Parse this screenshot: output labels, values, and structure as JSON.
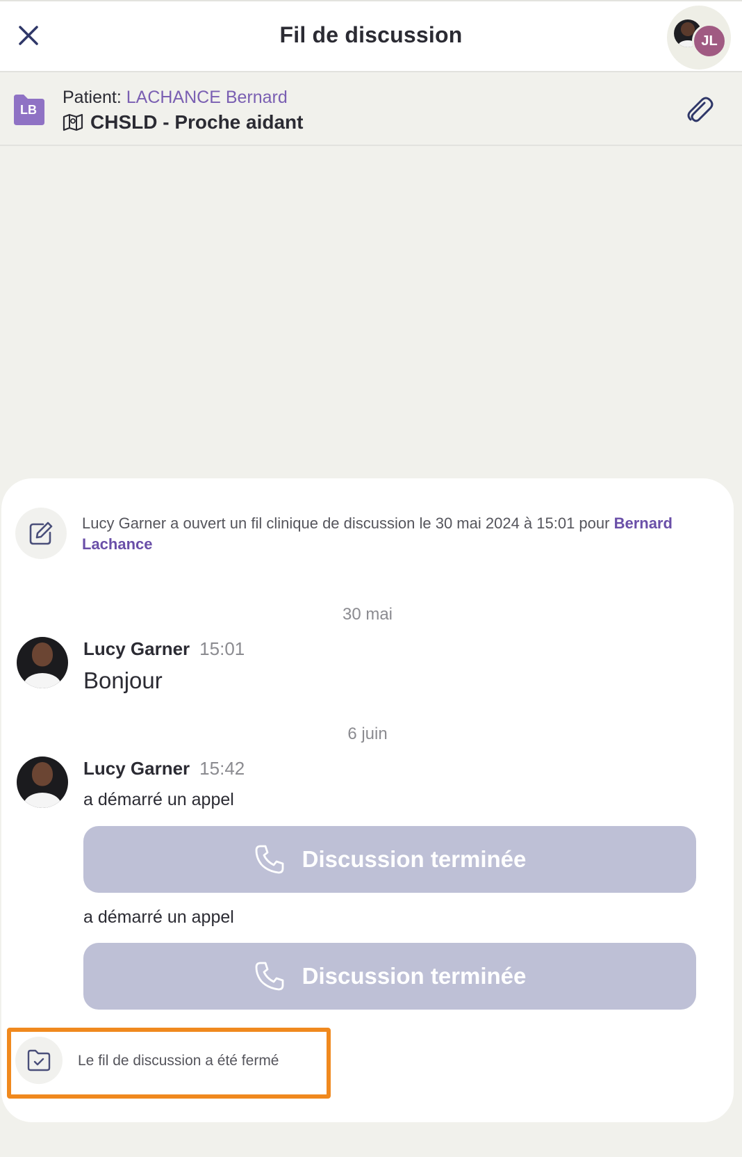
{
  "header": {
    "title": "Fil de discussion",
    "participants_badge": "JL"
  },
  "patient": {
    "initials": "LB",
    "label": "Patient: ",
    "name": "LACHANCE Bernard",
    "group": "CHSLD - Proche aidant"
  },
  "thread": {
    "opened_event": {
      "text": "Lucy Garner a ouvert un fil clinique de discussion le 30 mai 2024 à 15:01 pour ",
      "link": "Bernard Lachance"
    },
    "groups": [
      {
        "date": "30 mai",
        "author": "Lucy Garner",
        "time": "15:01",
        "text": "Bonjour"
      },
      {
        "date": "6 juin",
        "author": "Lucy Garner",
        "time": "15:42",
        "calls": [
          {
            "text": "a démarré un appel",
            "status": "Discussion terminée"
          },
          {
            "text": "a démarré un appel",
            "status": "Discussion terminée"
          }
        ]
      }
    ],
    "closed_event": {
      "text": "Le fil de discussion a été fermé"
    }
  },
  "colors": {
    "accent_purple": "#7a5fb2",
    "call_button_bg": "#bec0d6",
    "highlight_orange": "#f0891e",
    "avatar_jl_bg": "#a05a82"
  }
}
